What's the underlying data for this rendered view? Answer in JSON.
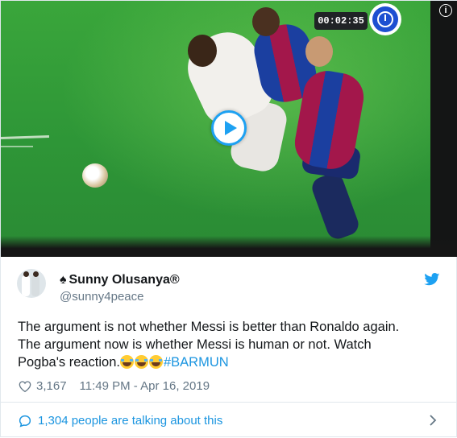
{
  "video": {
    "timer": "00:02:35",
    "info_symbol": "i"
  },
  "tweet": {
    "display_name": "Sunny Olusanya®",
    "name_prefix_symbol": "♠",
    "handle": "@sunny4peace",
    "text_line_1": "The argument is not whether Messi is better than Ronaldo again.",
    "text_line_2": "The argument now is whether Messi is human or not. Watch",
    "text_line_3": "Pogba's reaction.",
    "emojis": [
      "face-with-tears-of-joy",
      "face-with-tears-of-joy",
      "face-with-tears-of-joy"
    ],
    "hashtag": "#BARMUN",
    "like_count": "3,167",
    "timestamp": "11:49 PM - Apr 16, 2019",
    "talking_text": "1,304 people are talking about this"
  },
  "colors": {
    "link_blue": "#1b95e0",
    "twitter_blue": "#1da1f2",
    "secondary_text": "#657786",
    "primary_text": "#14171a",
    "divider": "#e1e8ed",
    "pitch_green": "#2f9a34"
  }
}
